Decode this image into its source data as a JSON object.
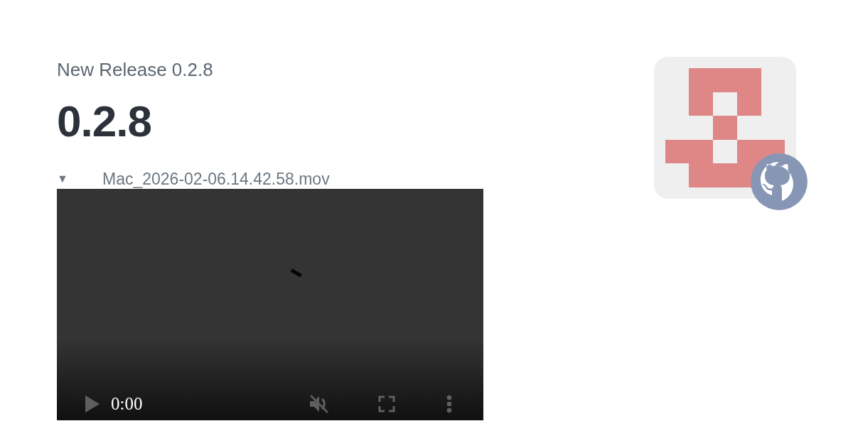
{
  "release": {
    "subtitle": "New Release 0.2.8",
    "title": "0.2.8"
  },
  "attachment": {
    "marker": "▼",
    "filename": "Mac_2026-02-06.14.42.58.mov"
  },
  "video": {
    "kind": "picture",
    "time": "0:00",
    "muted": true
  }
}
